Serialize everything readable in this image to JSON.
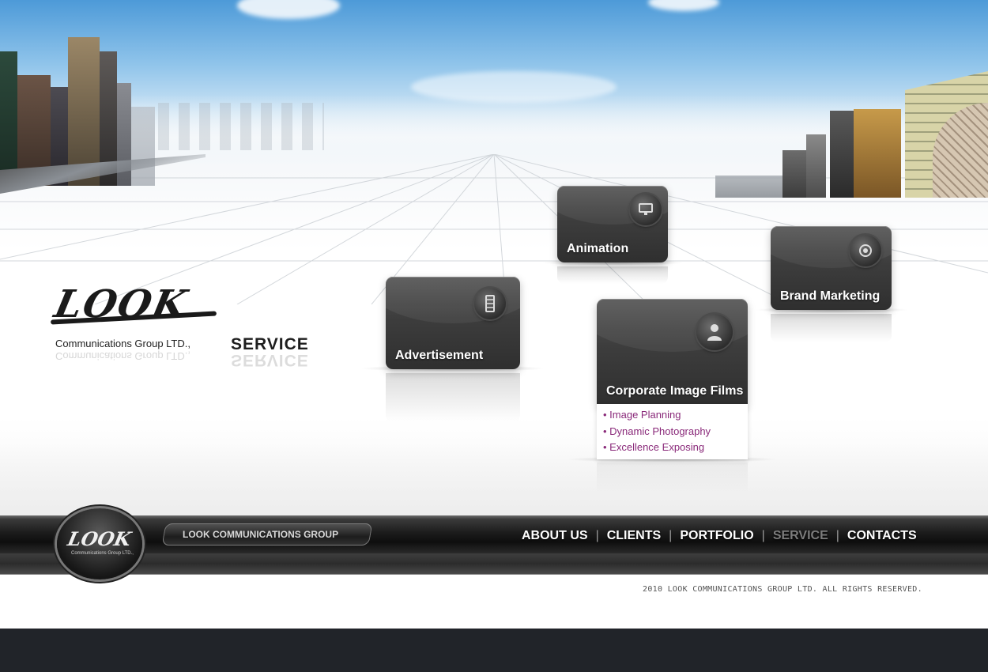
{
  "logo": {
    "wordmark": "LOOK",
    "company": "Communications Group LTD.,"
  },
  "page_heading": "SERVICE",
  "services": [
    {
      "label": "Animation",
      "icon": "monitor-icon"
    },
    {
      "label": "Brand Marketing",
      "icon": "target-icon"
    },
    {
      "label": "Advertisement",
      "icon": "film-strip-icon"
    },
    {
      "label": "Corporate Image Films",
      "icon": "person-icon"
    }
  ],
  "submenu": {
    "items": [
      "• Image Planning",
      "• Dynamic Photography",
      "• Excellence Exposing"
    ],
    "color": "#8a2a7a"
  },
  "navbar": {
    "logo_word": "LOOK",
    "logo_sub": "Communications Group LTD.,",
    "brand_label": "LOOK COMMUNICATIONS GROUP",
    "links": [
      "ABOUT US",
      "CLIENTS",
      "PORTFOLIO",
      "SERVICE",
      "CONTACTS"
    ],
    "active": "SERVICE",
    "separator": "|"
  },
  "copyright": "2010 LOOK COMMUNICATIONS GROUP LTD. ALL RIGHTS RESERVED."
}
